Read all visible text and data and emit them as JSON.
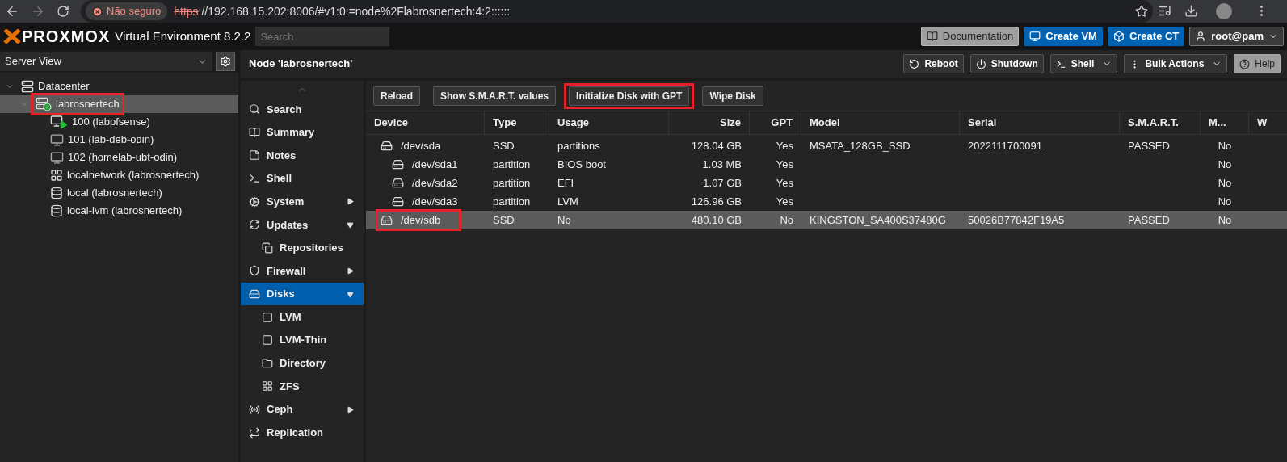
{
  "browser": {
    "security": "Não seguro",
    "url_scheme": "https",
    "url_rest": "://192.168.15.202:8006/#v1:0:=node%2Flabrosnertech:4:2::::::"
  },
  "header": {
    "brand": "PROXMOX",
    "product": "Virtual Environment 8.2.2",
    "search": {
      "placeholder": "Search"
    },
    "buttons": [
      {
        "kind": "doc",
        "label": "Documentation"
      },
      {
        "kind": "vm",
        "label": "Create VM"
      },
      {
        "kind": "ct",
        "label": "Create CT"
      },
      {
        "kind": "user",
        "label": "root@pam"
      }
    ]
  },
  "tree": {
    "view": "Server View",
    "items": [
      {
        "kind": "datacenter",
        "label": "Datacenter",
        "expanded": true,
        "selected": false,
        "annotated": false,
        "children": [
          {
            "kind": "node",
            "label": "labrosnertech",
            "expanded": true,
            "selected": true,
            "annotated": true,
            "children": [
              {
                "kind": "vm-running",
                "label": "100 (labpfsense)",
                "selected": false,
                "annotated": false
              },
              {
                "kind": "vm",
                "label": "101 (lab-deb-odin)",
                "selected": false,
                "annotated": false
              },
              {
                "kind": "vm",
                "label": "102 (homelab-ubt-odin)",
                "selected": false,
                "annotated": false
              },
              {
                "kind": "network",
                "label": "localnetwork (labrosnertech)",
                "selected": false,
                "annotated": false
              },
              {
                "kind": "storage",
                "label": "local (labrosnertech)",
                "selected": false,
                "annotated": false
              },
              {
                "kind": "storage",
                "label": "local-lvm (labrosnertech)",
                "selected": false,
                "annotated": false
              }
            ]
          }
        ]
      }
    ]
  },
  "node": {
    "title": "Node 'labrosnertech'",
    "actions": [
      {
        "kind": "reboot",
        "label": "Reboot"
      },
      {
        "kind": "shutdown",
        "label": "Shutdown"
      },
      {
        "kind": "shell",
        "label": "Shell"
      },
      {
        "kind": "bulk",
        "label": "Bulk Actions"
      },
      {
        "kind": "help",
        "label": "Help"
      }
    ]
  },
  "nav": [
    {
      "kind": "search",
      "label": "Search",
      "selected": false
    },
    {
      "kind": "summary",
      "label": "Summary",
      "selected": false
    },
    {
      "kind": "notes",
      "label": "Notes",
      "selected": false
    },
    {
      "kind": "shell",
      "label": "Shell",
      "selected": false
    },
    {
      "kind": "system",
      "label": "System",
      "selected": false,
      "expanded": false
    },
    {
      "kind": "updates",
      "label": "Updates",
      "selected": false,
      "expanded": true,
      "children": [
        {
          "kind": "repos",
          "label": "Repositories",
          "selected": false
        }
      ]
    },
    {
      "kind": "firewall",
      "label": "Firewall",
      "selected": false,
      "expanded": false
    },
    {
      "kind": "disks",
      "label": "Disks",
      "selected": true,
      "expanded": true,
      "children": [
        {
          "kind": "lvm",
          "label": "LVM",
          "selected": false
        },
        {
          "kind": "lvmthin",
          "label": "LVM-Thin",
          "selected": false
        },
        {
          "kind": "directory",
          "label": "Directory",
          "selected": false
        },
        {
          "kind": "zfs",
          "label": "ZFS",
          "selected": false
        }
      ]
    },
    {
      "kind": "ceph",
      "label": "Ceph",
      "selected": false,
      "expanded": false
    },
    {
      "kind": "replication",
      "label": "Replication",
      "selected": false
    }
  ],
  "toolbar": [
    {
      "label": "Reload",
      "annotated": false
    },
    {
      "label": "Show S.M.A.R.T. values",
      "annotated": false
    },
    {
      "label": "Initialize Disk with GPT",
      "annotated": true
    },
    {
      "label": "Wipe Disk",
      "annotated": false
    }
  ],
  "table": {
    "columns": [
      "Device",
      "Type",
      "Usage",
      "Size",
      "GPT",
      "Model",
      "Serial",
      "S.M.A.R.T.",
      "M...",
      "W"
    ],
    "rows": [
      {
        "device": "/dev/sda",
        "type": "SSD",
        "usage": "partitions",
        "size": "128.04 GB",
        "gpt": "Yes",
        "model": "MSATA_128GB_SSD",
        "serial": "2022111700091",
        "smart": "PASSED",
        "mounted": "No",
        "selected": false,
        "annotated": false,
        "children": [
          {
            "device": "/dev/sda1",
            "type": "partition",
            "usage": "BIOS boot",
            "size": "1.03 MB",
            "gpt": "Yes",
            "mounted": "No",
            "selected": false,
            "annotated": false
          },
          {
            "device": "/dev/sda2",
            "type": "partition",
            "usage": "EFI",
            "size": "1.07 GB",
            "gpt": "Yes",
            "mounted": "No",
            "selected": false,
            "annotated": false
          },
          {
            "device": "/dev/sda3",
            "type": "partition",
            "usage": "LVM",
            "size": "126.96 GB",
            "gpt": "Yes",
            "mounted": "No",
            "selected": false,
            "annotated": false
          }
        ]
      },
      {
        "device": "/dev/sdb",
        "type": "SSD",
        "usage": "No",
        "size": "480.10 GB",
        "gpt": "No",
        "model": "KINGSTON_SA400S37480G",
        "serial": "50026B77842F19A5",
        "smart": "PASSED",
        "mounted": "No",
        "selected": true,
        "annotated": true
      }
    ]
  }
}
